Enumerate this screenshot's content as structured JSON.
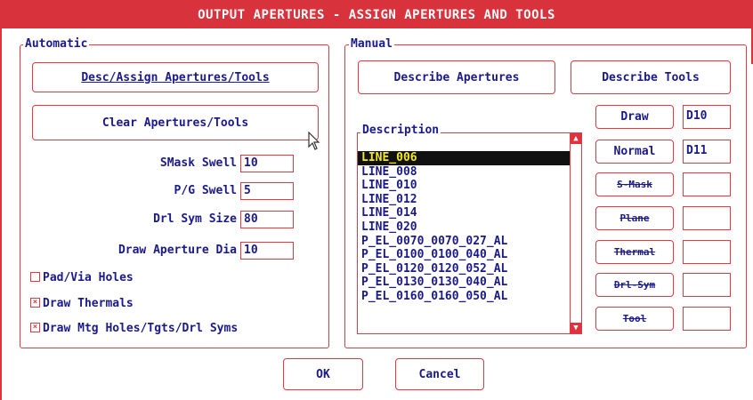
{
  "title": "OUTPUT APERTURES - ASSIGN APERTURES AND TOOLS",
  "automatic": {
    "legend": "Automatic",
    "desc_assign_button": "Desc/Assign Apertures/Tools",
    "clear_button": "Clear Apertures/Tools",
    "fields": [
      {
        "label": "SMask Swell",
        "value": "10"
      },
      {
        "label": "P/G Swell",
        "value": "5"
      },
      {
        "label": "Drl Sym Size",
        "value": "80"
      },
      {
        "label": "Draw Aperture Dia",
        "value": "10"
      }
    ],
    "checkboxes": [
      {
        "label": "Pad/Via Holes",
        "checked": false,
        "mark": ""
      },
      {
        "label": "Draw Thermals",
        "checked": true,
        "mark": "×"
      },
      {
        "label": "Draw Mtg Holes/Tgts/Drl Syms",
        "checked": true,
        "mark": "×"
      }
    ]
  },
  "manual": {
    "legend": "Manual",
    "describe_apertures_button": "Describe Apertures",
    "describe_tools_button": "Describe Tools",
    "description": {
      "legend": "Description",
      "items": [
        "LINE_006",
        "LINE_008",
        "LINE_010",
        "LINE_012",
        "LINE_014",
        "LINE_020",
        "P_EL_0070_0070_027_AL",
        "P_EL_0100_0100_040_AL",
        "P_EL_0120_0120_052_AL",
        "P_EL_0130_0130_040_AL",
        "P_EL_0160_0160_050_AL"
      ],
      "selected_index": 0,
      "scroll_up_icon": "arrow-up-icon",
      "scroll_down_icon": "arrow-down-icon"
    },
    "assign_buttons": [
      {
        "label": "Draw",
        "value": "D10",
        "enabled": true
      },
      {
        "label": "Normal",
        "value": "D11",
        "enabled": true
      },
      {
        "label": "S-Mask",
        "value": "",
        "enabled": false
      },
      {
        "label": "Plane",
        "value": "",
        "enabled": false
      },
      {
        "label": "Thermal",
        "value": "",
        "enabled": false
      },
      {
        "label": "Drl-Sym",
        "value": "",
        "enabled": false
      },
      {
        "label": "Tool",
        "value": "",
        "enabled": false
      }
    ]
  },
  "footer": {
    "ok": "OK",
    "cancel": "Cancel"
  },
  "colors": {
    "title_bg": "#d8323c",
    "border": "#e03a44",
    "text": "#1a1a8a",
    "selection_bg": "#111111",
    "selection_text": "#f2ea1c"
  }
}
